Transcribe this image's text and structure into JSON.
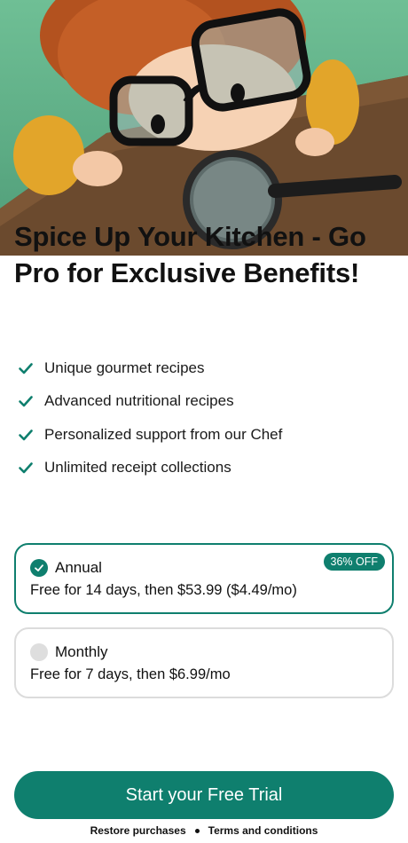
{
  "hero": {
    "image_name": "chef-kid-magnifying-glass-illustration",
    "headline": "Spice Up Your Kitchen - Go Pro for Exclusive Benefits!"
  },
  "features": [
    {
      "icon": "check-icon",
      "label": "Unique gourmet recipes"
    },
    {
      "icon": "check-icon",
      "label": "Advanced nutritional recipes"
    },
    {
      "icon": "check-icon",
      "label": "Personalized support from our Chef"
    },
    {
      "icon": "check-icon",
      "label": "Unlimited receipt collections"
    }
  ],
  "plans": {
    "annual": {
      "name": "Annual",
      "description": "Free for 14 days, then $53.99 ($4.49/mo)",
      "badge": "36% OFF",
      "selected": true
    },
    "monthly": {
      "name": "Monthly",
      "description": "Free for 7 days, then $6.99/mo",
      "selected": false
    }
  },
  "cta": {
    "label": "Start your Free Trial"
  },
  "footer": {
    "restore": "Restore purchases",
    "terms": "Terms and conditions"
  },
  "colors": {
    "accent": "#0f7f6e",
    "background": "#ffffff",
    "text": "#111111"
  }
}
